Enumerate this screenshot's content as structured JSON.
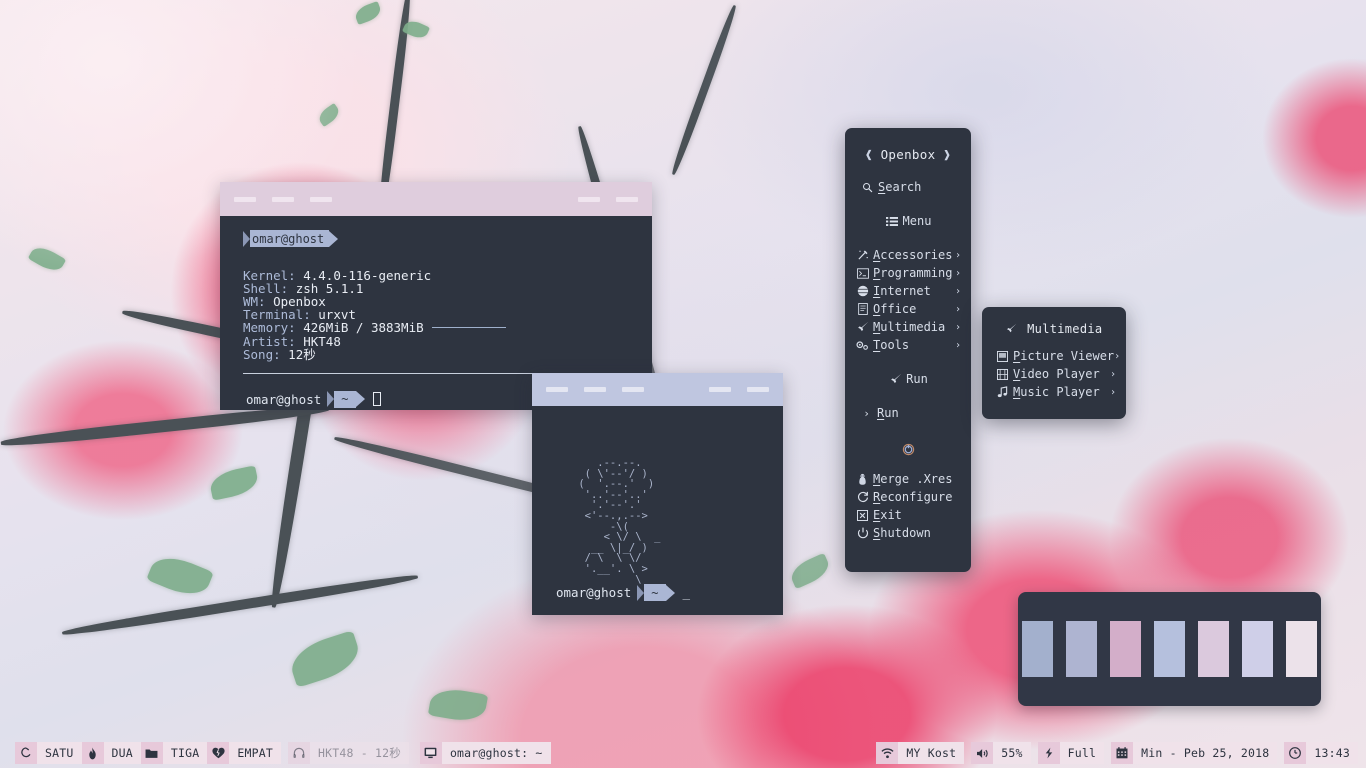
{
  "desktop": {
    "wallpaper_description": "blurred pink quince blossom branch photograph"
  },
  "terminal1": {
    "titlebar": {
      "left_buttons": [
        "-",
        "-",
        "-"
      ],
      "right_buttons": [
        "-",
        "-"
      ]
    },
    "prompt_top": "omar@ghost",
    "fetch": [
      {
        "key": "Kernel:",
        "value": "4.4.0-116-generic"
      },
      {
        "key": "Shell:",
        "value": "zsh 5.1.1"
      },
      {
        "key": "WM:",
        "value": "Openbox"
      },
      {
        "key": "Terminal:",
        "value": "urxvt"
      },
      {
        "key": "Memory:",
        "value": "426MiB / 3883MiB"
      },
      {
        "key": "Artist:",
        "value": "HKT48"
      },
      {
        "key": "Song:",
        "value": "12秒"
      }
    ],
    "prompt_bottom_user": "omar@ghost",
    "prompt_bottom_path": "~"
  },
  "terminal2": {
    "titlebar": {
      "left_buttons": [
        "-",
        "-",
        "-"
      ],
      "right_buttons": [
        "-",
        "-"
      ]
    },
    "ascii_art": "    .--.--.\n  ( \\'--'/ )\n (  '.--.'  )\n  '..'--'..'\n   '.'--'.'\n  <'--.,.-->\n      -\\(\n     < \\/ \\  _\n   __ \\|_/ )\n  / \\  \\ \\/\n  '.__'. \\ >\n          \\",
    "prompt_user": "omar@ghost",
    "prompt_path": "~",
    "cursor": "_"
  },
  "openbox_menu": {
    "title": "Openbox",
    "bracket_left": "❰",
    "bracket_right": "❱",
    "search_label": "Search",
    "menu_label": "Menu",
    "categories": [
      {
        "label": "Accessories",
        "icon": "wand-icon",
        "chevron": "›"
      },
      {
        "label": "Programming",
        "icon": "terminal-icon",
        "chevron": "›"
      },
      {
        "label": "Internet",
        "icon": "globe-icon",
        "chevron": "›"
      },
      {
        "label": "Office",
        "icon": "document-icon",
        "chevron": "›"
      },
      {
        "label": "Multimedia",
        "icon": "rocket-icon",
        "chevron": "›"
      },
      {
        "label": "Tools",
        "icon": "gears-icon",
        "chevron": "›"
      }
    ],
    "run_header": "Run",
    "run_item": {
      "label": "Run",
      "prefix": "›"
    },
    "divider_icon": "power-circle-icon",
    "actions": [
      {
        "label": "Merge .Xres",
        "icon": "tux-icon"
      },
      {
        "label": "Reconfigure",
        "icon": "refresh-icon"
      },
      {
        "label": "Exit",
        "icon": "exit-icon"
      },
      {
        "label": "Shutdown",
        "icon": "power-icon"
      }
    ]
  },
  "multimedia_submenu": {
    "title": "Multimedia",
    "title_icon": "rocket-icon",
    "items": [
      {
        "label": "Picture Viewer",
        "icon": "image-icon",
        "chevron": "›"
      },
      {
        "label": "Video Player",
        "icon": "film-icon",
        "chevron": "›"
      },
      {
        "label": "Music Player",
        "icon": "note-icon",
        "chevron": "›"
      }
    ]
  },
  "palette_widget": {
    "swatches": [
      "#a3b0cd",
      "#aeb4d1",
      "#d3aec9",
      "#b5c0dd",
      "#dbc9dd",
      "#cfcfe8",
      "#ece2ea"
    ]
  },
  "taskbar": {
    "workspaces": [
      {
        "label": "SATU",
        "icon": "ghost-icon"
      },
      {
        "label": "DUA",
        "icon": "flame-icon"
      },
      {
        "label": "TIGA",
        "icon": "folder-icon"
      },
      {
        "label": "EMPAT",
        "icon": "heart-icon"
      }
    ],
    "now_playing": {
      "label": "HKT48 - 12秒",
      "icon": "headphones-icon"
    },
    "window_task": {
      "label": "omar@ghost: ~",
      "icon": "monitor-icon"
    },
    "tray": [
      {
        "label": "MY Kost",
        "icon": "wifi-icon"
      },
      {
        "label": "55%",
        "icon": "volume-icon"
      },
      {
        "label": "Full",
        "icon": "battery-plug-icon"
      },
      {
        "label": "Min - Peb 25, 2018",
        "icon": "calendar-icon"
      },
      {
        "label": "13:43",
        "icon": "clock-icon"
      }
    ]
  },
  "colors": {
    "terminal_bg": "#2e3440",
    "menu_bg": "#2e3440",
    "titlebar_1": "#dfcddd",
    "titlebar_2": "#bfc6e0",
    "taskbar_icon_bg": "#e7c9da",
    "taskbar_text_bg": "#f0e2ea",
    "text_light": "#d8dee9"
  }
}
